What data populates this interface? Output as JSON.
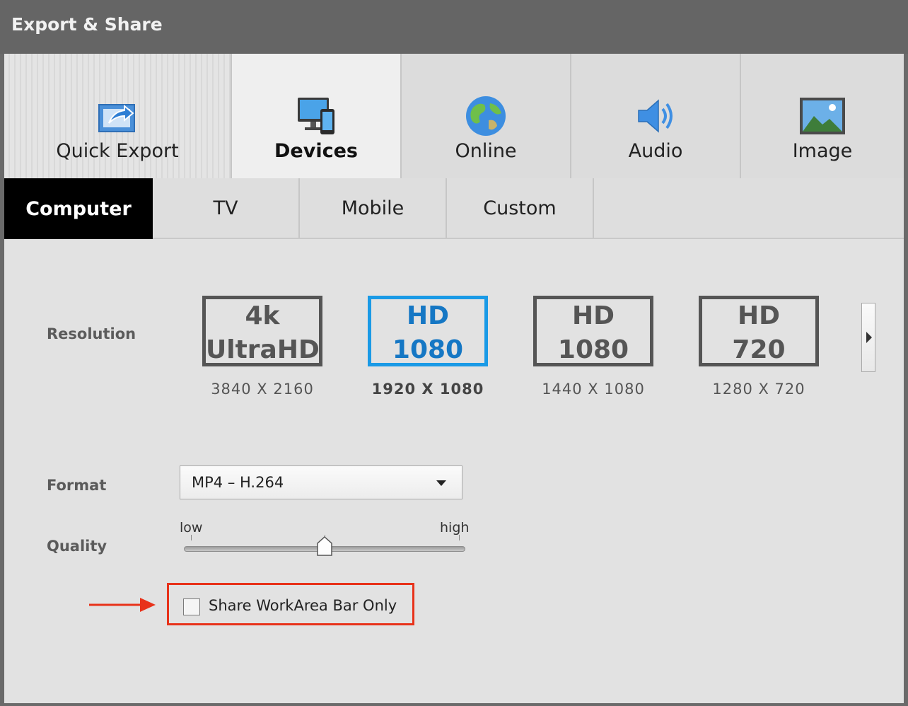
{
  "window": {
    "title": "Export & Share"
  },
  "main_tabs": [
    {
      "label": "Quick Export",
      "icon": "quick-export-icon",
      "active": false
    },
    {
      "label": "Devices",
      "icon": "devices-icon",
      "active": true
    },
    {
      "label": "Online",
      "icon": "globe-icon",
      "active": false
    },
    {
      "label": "Audio",
      "icon": "speaker-icon",
      "active": false
    },
    {
      "label": "Image",
      "icon": "picture-icon",
      "active": false
    }
  ],
  "sub_tabs": [
    {
      "label": "Computer",
      "active": true
    },
    {
      "label": "TV",
      "active": false
    },
    {
      "label": "Mobile",
      "active": false
    },
    {
      "label": "Custom",
      "active": false
    }
  ],
  "resolution": {
    "label": "Resolution",
    "options": [
      {
        "line1": "4k",
        "line2": "UltraHD",
        "dimensions": "3840 X 2160",
        "selected": false
      },
      {
        "line1": "HD",
        "line2": "1080",
        "dimensions": "1920 X 1080",
        "selected": true
      },
      {
        "line1": "HD",
        "line2": "1080",
        "dimensions": "1440 X 1080",
        "selected": false
      },
      {
        "line1": "HD",
        "line2": "720",
        "dimensions": "1280 X 720",
        "selected": false
      }
    ]
  },
  "format": {
    "label": "Format",
    "value": "MP4 – H.264"
  },
  "quality": {
    "label": "Quality",
    "low_label": "low",
    "high_label": "high",
    "level": 0.5
  },
  "share_workarea": {
    "label": "Share WorkArea Bar Only",
    "checked": false
  },
  "colors": {
    "selected": "#1a9ae6",
    "highlight": "#e8321a",
    "active_tab": "#000000"
  }
}
